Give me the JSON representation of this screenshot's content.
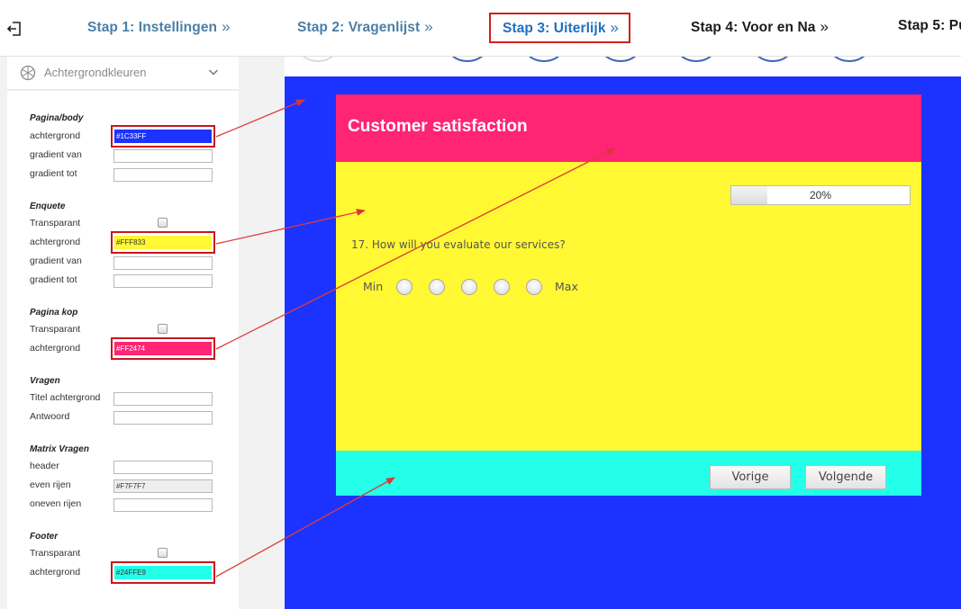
{
  "steps": [
    {
      "label": "Stap 1: Instellingen",
      "chevron": "»",
      "state": "done"
    },
    {
      "label": "Stap 2: Vragenlijst",
      "chevron": "»",
      "state": "done"
    },
    {
      "label": "Stap 3: Uiterlijk",
      "chevron": "»",
      "state": "active"
    },
    {
      "label": "Stap 4: Voor en Na",
      "chevron": "»",
      "state": "todo"
    },
    {
      "label": "Stap 5: Pu",
      "chevron": "",
      "state": "todo"
    }
  ],
  "panel": {
    "title": "Achtergrondkleuren",
    "sections": {
      "page": {
        "title": "Pagina/body",
        "bg_label": "achtergrond",
        "bg_value": "#1C33FF",
        "grad_from": "gradient van",
        "grad_to": "gradient tot"
      },
      "survey": {
        "title": "Enquete",
        "transparent": "Transparant",
        "bg_label": "achtergrond",
        "bg_value": "#FFF833",
        "grad_from": "gradient van",
        "grad_to": "gradient tot"
      },
      "header": {
        "title": "Pagina kop",
        "transparent": "Transparant",
        "bg_label": "achtergrond",
        "bg_value": "#FF2474"
      },
      "questions": {
        "title": "Vragen",
        "title_bg": "Titel achtergrond",
        "answer": "Antwoord"
      },
      "matrix": {
        "title": "Matrix Vragen",
        "header": "header",
        "even": "even rijen",
        "even_value": "#F7F7F7",
        "odd": "oneven rijen"
      },
      "footer": {
        "title": "Footer",
        "transparent": "Transparant",
        "bg_label": "achtergrond",
        "bg_value": "#24FFE9"
      }
    }
  },
  "colors": {
    "page": "#1C33FF",
    "survey": "#FFF833",
    "header": "#FF2474",
    "footer": "#24FFE9",
    "even_rows": "#F7F7F7",
    "highlight": "#C8171A"
  },
  "survey": {
    "title": "Customer satisfaction",
    "progress_value": 0.2,
    "progress_text": "20%",
    "question": "17. How will you evaluate our services?",
    "scale_min": "Min",
    "scale_max": "Max",
    "prev_button": "Vorige",
    "next_button": "Volgende"
  },
  "icons": {
    "back": "exit-icon",
    "panel": "palette-icon",
    "collapse": "chevron-down-icon"
  }
}
